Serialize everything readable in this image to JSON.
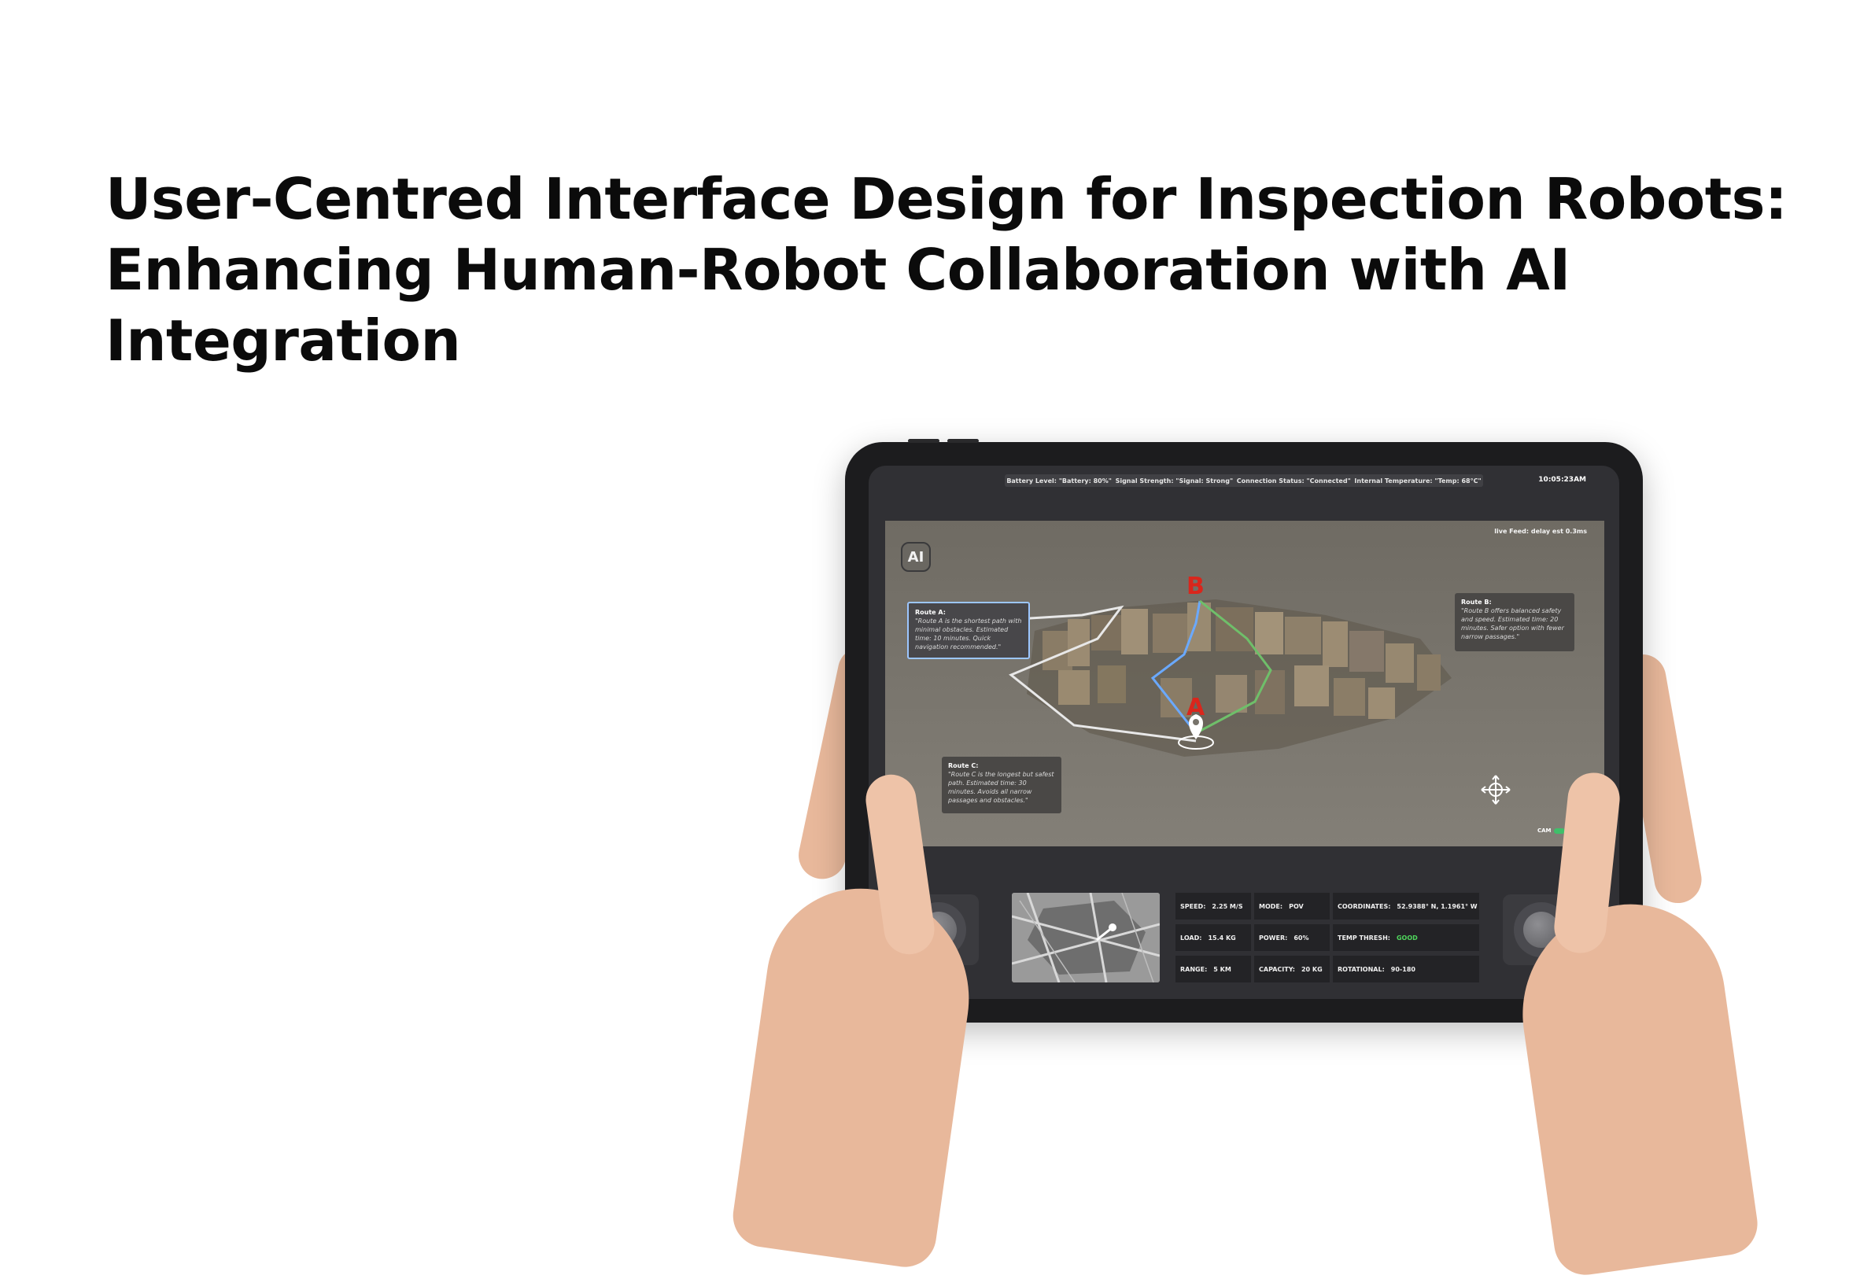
{
  "headline": {
    "line1": "User-Centred Interface Design for Inspection Robots:",
    "line2": "Enhancing Human-Robot Collaboration with AI",
    "line3": "Integration"
  },
  "status_bar": {
    "battery": "Battery Level: \"Battery: 80%\"",
    "signal": "Signal Strength: \"Signal: Strong\"",
    "connection": "Connection Status: \"Connected\"",
    "temperature": "Internal Temperature: \"Temp: 68°C\"",
    "clock": "10:05:23AM"
  },
  "live_feed": {
    "label": "live Feed: delay est 0.3ms",
    "ai_button": "AI",
    "markers": {
      "a": "A",
      "b": "B"
    },
    "route_a": {
      "title": "Route A:",
      "body": "\"Route A is the shortest path with minimal obstacles. Estimated time: 10 minutes. Quick navigation recommended.\""
    },
    "route_b": {
      "title": "Route B:",
      "body": "\"Route B offers balanced safety and speed. Estimated time: 20 minutes. Safer option with fewer narrow passages.\""
    },
    "route_c": {
      "title": "Route C:",
      "body": "\"Route C is the longest but safest path. Estimated time: 30 minutes. Avoids all narrow passages and obstacles.\""
    },
    "cam_label": "CAM"
  },
  "telemetry": {
    "speed_label": "SPEED:",
    "speed_value": "2.25 M/S",
    "mode_label": "MODE:",
    "mode_value": "POV",
    "coords_label": "COORDINATES:",
    "coords_value": "52.9388° N, 1.1961° W",
    "load_label": "LOAD:",
    "load_value": "15.4 KG",
    "power_label": "POWER:",
    "power_value": "60%",
    "temp_label": "TEMP THRESH:",
    "temp_value": "GOOD",
    "range_label": "RANGE:",
    "range_value": "5 KM",
    "capacity_label": "CAPACITY:",
    "capacity_value": "20 KG",
    "rotational_label": "ROTATIONAL:",
    "rotational_value": "90-180"
  },
  "colors": {
    "route_a": "#6aa9ff",
    "route_b": "#6fbf6a",
    "route_c": "#e8e8e8",
    "marker": "#d9261c",
    "good": "#4fd65c"
  },
  "icons": [
    "joystick-left-icon",
    "joystick-right-icon",
    "navigation-compass-icon",
    "location-pin-icon"
  ]
}
